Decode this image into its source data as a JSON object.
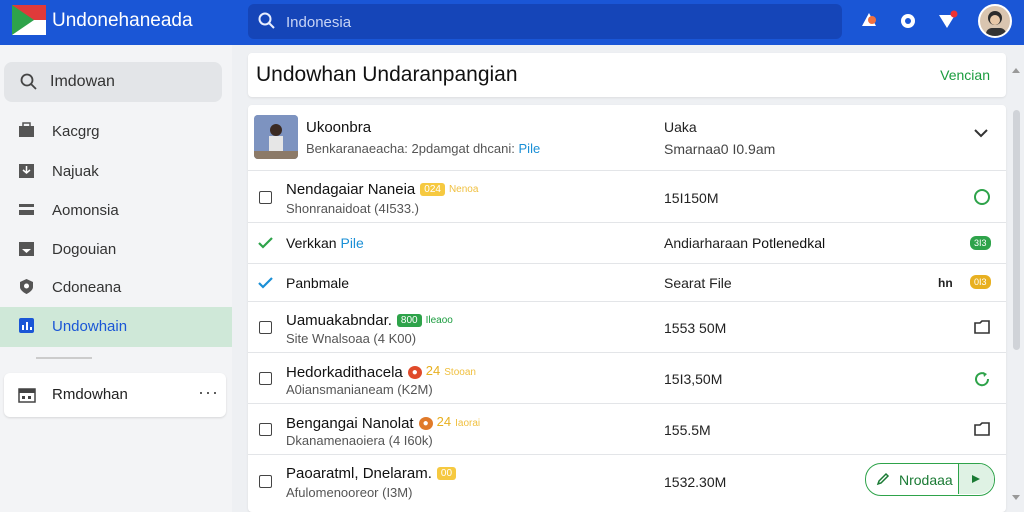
{
  "app": {
    "title": "Undonehaneada"
  },
  "search": {
    "placeholder": "Indonesia"
  },
  "sidebar": {
    "search_label": "Imdowan",
    "items": [
      {
        "label": "Kacgrg",
        "icon": "briefcase-icon"
      },
      {
        "label": "Najuak",
        "icon": "download-icon"
      },
      {
        "label": "Aomonsia",
        "icon": "menu-icon"
      },
      {
        "label": "Dogouian",
        "icon": "inbox-icon"
      },
      {
        "label": "Cdoneana",
        "icon": "shield-icon"
      },
      {
        "label": "Undowhain",
        "icon": "chart-icon"
      }
    ],
    "active_index": 5,
    "card": {
      "label": "Rmdowhan",
      "more": "···"
    }
  },
  "main": {
    "title": "Undowhan Undaranpangian",
    "version_link": "Vencian",
    "head_row": {
      "title": "Ukoonbra",
      "subtitle_text": "Benkaranaeacha: 2pdamgat dhcani:",
      "subtitle_link": "Pile",
      "col2": "Uaka",
      "col2_sub": "Smarnaa0 I0.9am"
    },
    "rows": [
      {
        "title": "Nendagaiar Naneia",
        "tag": "024",
        "tag_note": "Nenoa",
        "sub": "Shonranaidoat (4I533.)",
        "size": "15I150M",
        "action": "circle-icon"
      },
      {
        "title": "Verkkan",
        "title_link": "Pile",
        "col2_a": "Andiarharaan",
        "col2_b": "Potlenedkal",
        "badge": "3I3",
        "action": "badge"
      },
      {
        "title": "Panbmale",
        "col2": "Searat File",
        "extra": "hn",
        "badge": "0I3",
        "action": "badge"
      },
      {
        "title": "Uamuakabndar.",
        "tag": "800",
        "tag_note": "Ileaoo",
        "sub": "Site Wnalsoaa (4 K00)",
        "size": "1553 50M",
        "action": "folder-icon"
      },
      {
        "title": "Hedorkadithacela",
        "tag": "24",
        "tag_note": "Stooan",
        "sub": "A0iansmanianeam (K2M)",
        "size": "15I3,50M",
        "action": "refresh-icon"
      },
      {
        "title": "Bengangai Nanolat",
        "tag": "24",
        "tag_note": "Iaorai",
        "sub": "Dkanamenaoiera (4 I60k)",
        "size": "155.5M",
        "action": "folder-icon"
      },
      {
        "title": "Paoaratml, Dnelaram.",
        "tag": "00",
        "tag_note": "",
        "sub": "Afulomenooreor (I3M)",
        "size": "1532.30M",
        "action": "button",
        "button_label": "Nrodaaa"
      }
    ]
  }
}
